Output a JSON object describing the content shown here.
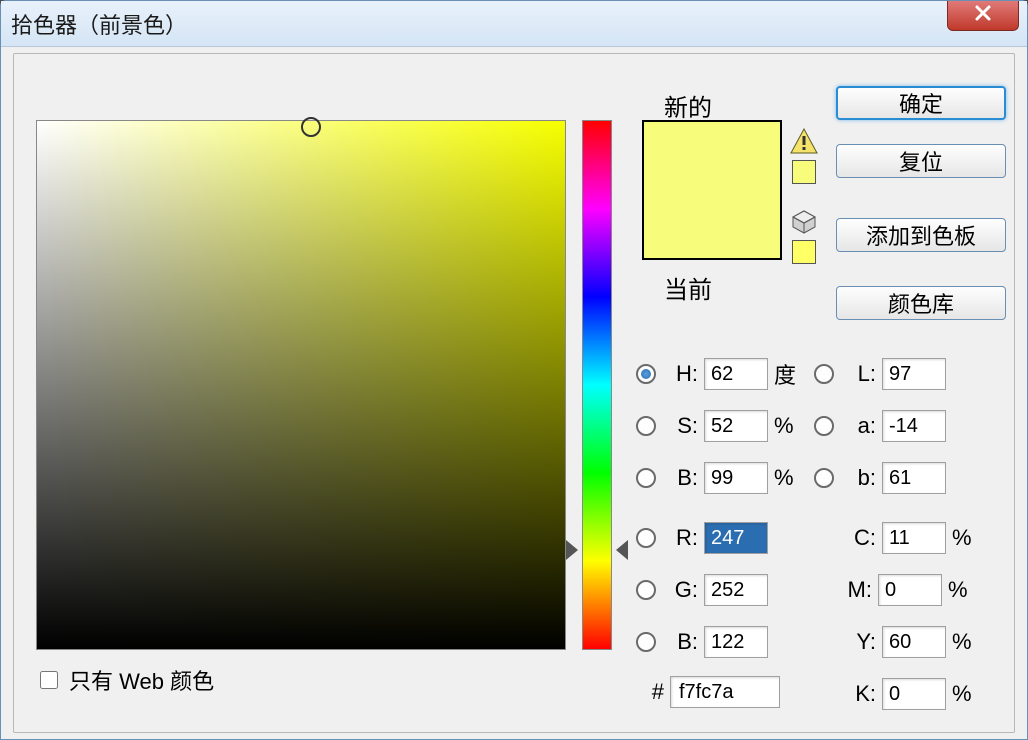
{
  "title": "拾色器（前景色）",
  "buttons": {
    "ok": "确定",
    "reset": "复位",
    "add_swatch": "添加到色板",
    "color_lib": "颜色库"
  },
  "swatch": {
    "new_label": "新的",
    "current_label": "当前",
    "new_color": "#f7fc7a",
    "current_color": "#f7fc7a"
  },
  "web_only_label": "只有 Web 颜色",
  "fields": {
    "H": {
      "label": "H:",
      "value": "62",
      "unit": "度",
      "selected": true
    },
    "S": {
      "label": "S:",
      "value": "52",
      "unit": "%",
      "selected": false
    },
    "B": {
      "label": "B:",
      "value": "99",
      "unit": "%",
      "selected": false
    },
    "R": {
      "label": "R:",
      "value": "247",
      "selected": false,
      "highlight": true
    },
    "G": {
      "label": "G:",
      "value": "252",
      "selected": false
    },
    "B2": {
      "label": "B:",
      "value": "122",
      "selected": false
    },
    "L": {
      "label": "L:",
      "value": "97",
      "selected": false
    },
    "a": {
      "label": "a:",
      "value": "-14",
      "selected": false
    },
    "b": {
      "label": "b:",
      "value": "61",
      "selected": false
    },
    "C": {
      "label": "C:",
      "value": "11",
      "unit": "%"
    },
    "M": {
      "label": "M:",
      "value": "0",
      "unit": "%"
    },
    "Y": {
      "label": "Y:",
      "value": "60",
      "unit": "%"
    },
    "K": {
      "label": "K:",
      "value": "0",
      "unit": "%"
    }
  },
  "hex": {
    "prefix": "#",
    "value": "f7fc7a"
  }
}
